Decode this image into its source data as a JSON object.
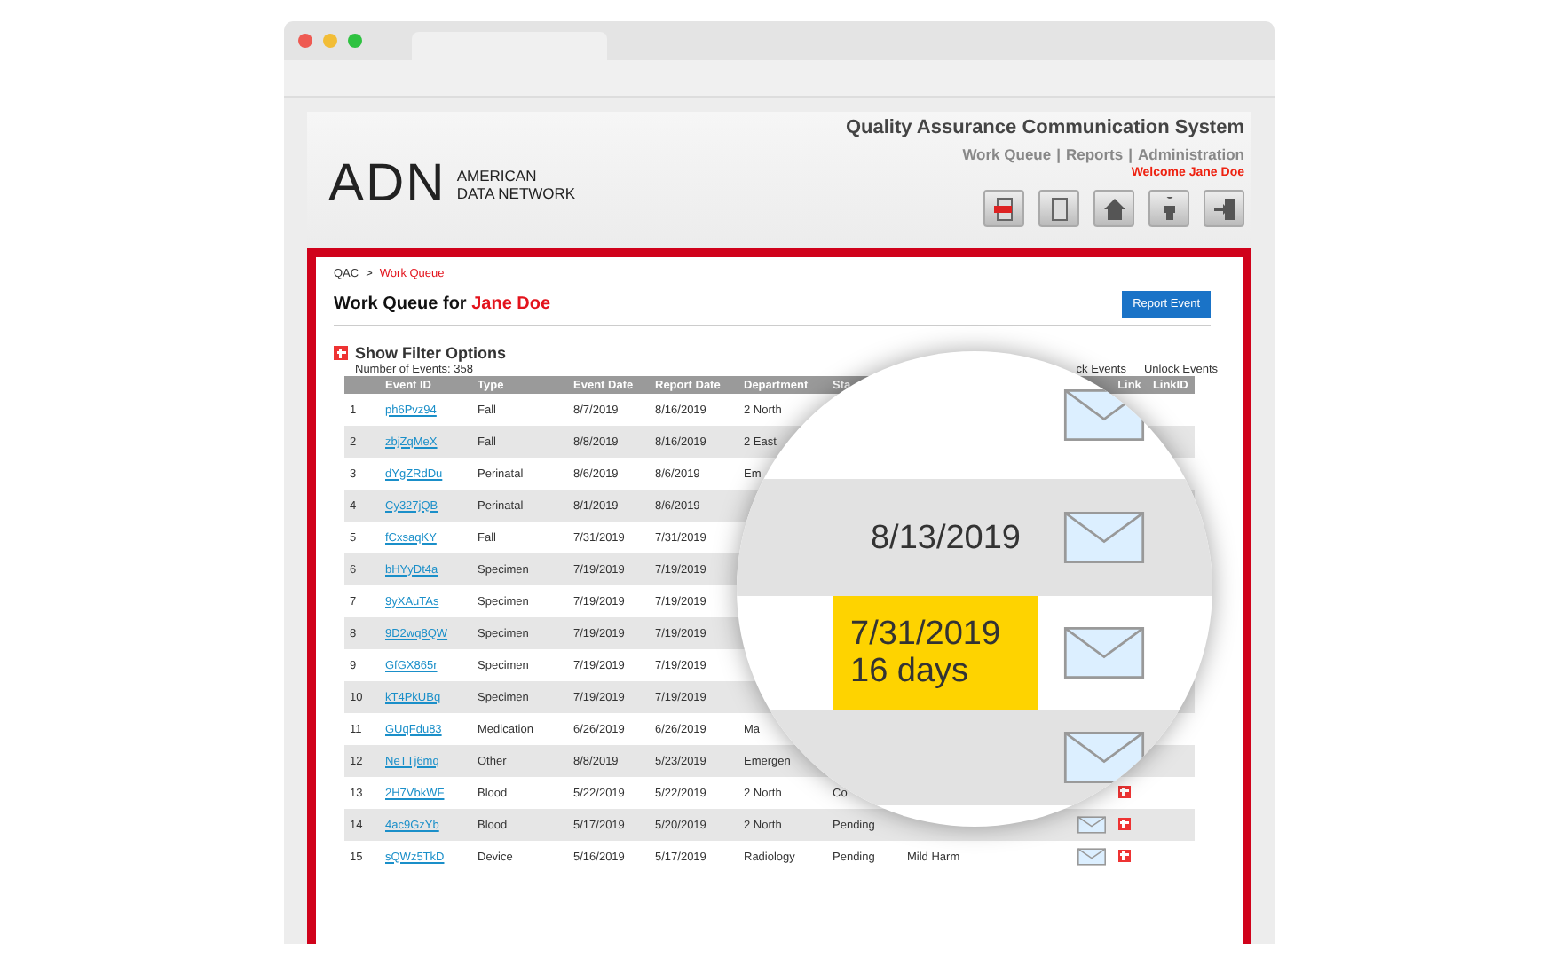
{
  "app": {
    "title": "Quality Assurance Communication System",
    "logo_mark": "ADN",
    "logo_line1": "AMERICAN",
    "logo_line2": "DATA NETWORK",
    "nav": [
      {
        "label": "Work Queue",
        "separator": "|"
      },
      {
        "label": "Reports",
        "separator": "|"
      },
      {
        "label": "Administration"
      }
    ],
    "welcome": "Welcome Jane Doe"
  },
  "breadcrumb": {
    "root": "QAC",
    "separator": ">",
    "current": "Work Queue"
  },
  "heading": {
    "prefix": "Work Queue for",
    "name": "Jane Doe"
  },
  "report_button": "Report Event",
  "filter_toggle": "Show Filter Options",
  "event_count": "Number of Events: 358",
  "lock_actions": [
    "ck Events",
    "Unlock Events"
  ],
  "table": {
    "columns": [
      "",
      "Event ID",
      "Type",
      "Event Date",
      "Report Date",
      "Department",
      "Sta",
      "",
      "",
      "Link",
      "LinkID"
    ],
    "rows": [
      {
        "num": "1",
        "id": "ph6Pvz94",
        "type": "Fall",
        "event_date": "8/7/2019",
        "report_date": "8/16/2019",
        "department": "2 North",
        "status": "",
        "harm": "",
        "lock": false,
        "link": false
      },
      {
        "num": "2",
        "id": "zbjZqMeX",
        "type": "Fall",
        "event_date": "8/8/2019",
        "report_date": "8/16/2019",
        "department": "2 East",
        "status": "",
        "harm": "",
        "lock": false,
        "link": false
      },
      {
        "num": "3",
        "id": "dYgZRdDu",
        "type": "Perinatal",
        "event_date": "8/6/2019",
        "report_date": "8/6/2019",
        "department": "Em",
        "status": "",
        "harm": "",
        "lock": false,
        "link": false
      },
      {
        "num": "4",
        "id": "Cy327jQB",
        "type": "Perinatal",
        "event_date": "8/1/2019",
        "report_date": "8/6/2019",
        "department": "",
        "status": "",
        "harm": "",
        "lock": false,
        "link": false
      },
      {
        "num": "5",
        "id": "fCxsaqKY",
        "type": "Fall",
        "event_date": "7/31/2019",
        "report_date": "7/31/2019",
        "department": "",
        "status": "",
        "harm": "",
        "lock": false,
        "link": false
      },
      {
        "num": "6",
        "id": "bHYyDt4a",
        "type": "Specimen",
        "event_date": "7/19/2019",
        "report_date": "7/19/2019",
        "department": "",
        "status": "",
        "harm": "",
        "lock": false,
        "link": false
      },
      {
        "num": "7",
        "id": "9yXAuTAs",
        "type": "Specimen",
        "event_date": "7/19/2019",
        "report_date": "7/19/2019",
        "department": "",
        "status": "",
        "harm": "",
        "lock": false,
        "link": false
      },
      {
        "num": "8",
        "id": "9D2wq8QW",
        "type": "Specimen",
        "event_date": "7/19/2019",
        "report_date": "7/19/2019",
        "department": "",
        "status": "",
        "harm": "",
        "lock": false,
        "link": false
      },
      {
        "num": "9",
        "id": "GfGX865r",
        "type": "Specimen",
        "event_date": "7/19/2019",
        "report_date": "7/19/2019",
        "department": "",
        "status": "",
        "harm": "",
        "lock": false,
        "link": false
      },
      {
        "num": "10",
        "id": "kT4PkUBq",
        "type": "Specimen",
        "event_date": "7/19/2019",
        "report_date": "7/19/2019",
        "department": "",
        "status": "",
        "harm": "",
        "lock": false,
        "link": false
      },
      {
        "num": "11",
        "id": "GUqFdu83",
        "type": "Medication",
        "event_date": "6/26/2019",
        "report_date": "6/26/2019",
        "department": "Ma",
        "status": "",
        "harm": "",
        "lock": false,
        "link": false
      },
      {
        "num": "12",
        "id": "NeTTj6mq",
        "type": "Other",
        "event_date": "8/8/2019",
        "report_date": "5/23/2019",
        "department": "Emergen",
        "status": "",
        "harm": "",
        "lock": false,
        "link": false
      },
      {
        "num": "13",
        "id": "2H7VbkWF",
        "type": "Blood",
        "event_date": "5/22/2019",
        "report_date": "5/22/2019",
        "department": "2 North",
        "status": "Co",
        "harm": "",
        "lock": false,
        "link": true
      },
      {
        "num": "14",
        "id": "4ac9GzYb",
        "type": "Blood",
        "event_date": "5/17/2019",
        "report_date": "5/20/2019",
        "department": "2 North",
        "status": "Pending",
        "harm": "",
        "lock": true,
        "link": true
      },
      {
        "num": "15",
        "id": "sQWz5TkD",
        "type": "Device",
        "event_date": "5/16/2019",
        "report_date": "5/17/2019",
        "department": "Radiology",
        "status": "Pending",
        "harm": "Mild Harm",
        "lock": true,
        "link": true
      }
    ]
  },
  "magnifier": {
    "rows": [
      {
        "lines": [],
        "highlighted": false,
        "envelope": true
      },
      {
        "lines": [
          "8/13/2019"
        ],
        "highlighted": false,
        "envelope": true
      },
      {
        "lines": [
          "7/31/2019",
          "16 days"
        ],
        "highlighted": true,
        "envelope": true
      },
      {
        "lines": [],
        "highlighted": false,
        "envelope": true
      }
    ]
  }
}
